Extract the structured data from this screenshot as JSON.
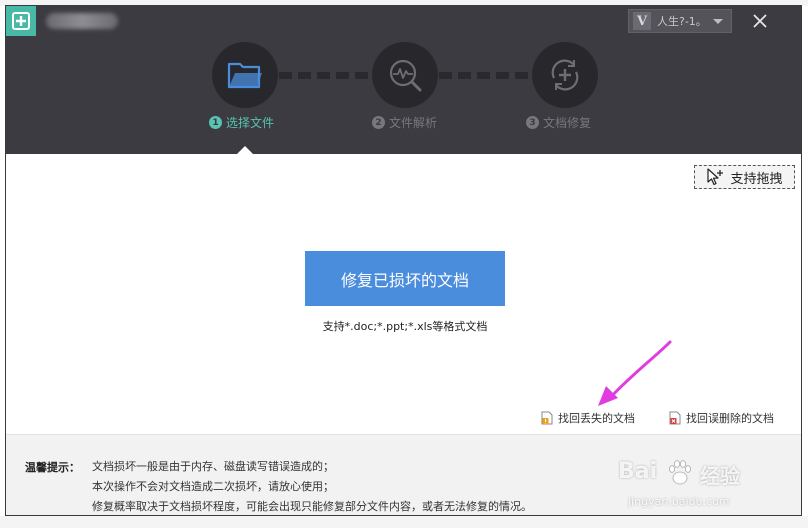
{
  "header": {
    "user_avatar_letter": "V",
    "user_name": "人生?-1。",
    "icons": {
      "logo": "plus-square-icon",
      "close": "close-icon",
      "dropdown": "chevron-down-icon"
    }
  },
  "steps": [
    {
      "number": "1",
      "label": "选择文件",
      "icon": "folder-icon",
      "active": true
    },
    {
      "number": "2",
      "label": "文件解析",
      "icon": "magnifier-pulse-icon",
      "active": false
    },
    {
      "number": "3",
      "label": "文档修复",
      "icon": "refresh-plus-icon",
      "active": false
    }
  ],
  "main": {
    "drag_label": "支持拖拽",
    "repair_button_label": "修复已损坏的文档",
    "supported_formats": "支持*.doc;*.ppt;*.xls等格式文档",
    "links": {
      "find_lost": "找回丢失的文档",
      "find_deleted": "找回误删除的文档"
    }
  },
  "footer": {
    "tips_title": "温馨提示：",
    "tips": [
      "文档损坏一般是由于内存、磁盘读写错误造成的；",
      "本次操作不会对文档造成二次损坏，请放心使用；",
      "修复概率取决于文档损坏程度，可能会出现只能修复部分文件内容，或者无法修复的情况。"
    ]
  },
  "watermark": {
    "brand": "Bai",
    "brand_suffix": "经验",
    "url": "jingyan.baidu.com"
  },
  "colors": {
    "header_bg": "#3c3b41",
    "accent_teal": "#57c3b0",
    "button_blue": "#4a8ddc",
    "arrow_magenta": "#e03ce0"
  }
}
